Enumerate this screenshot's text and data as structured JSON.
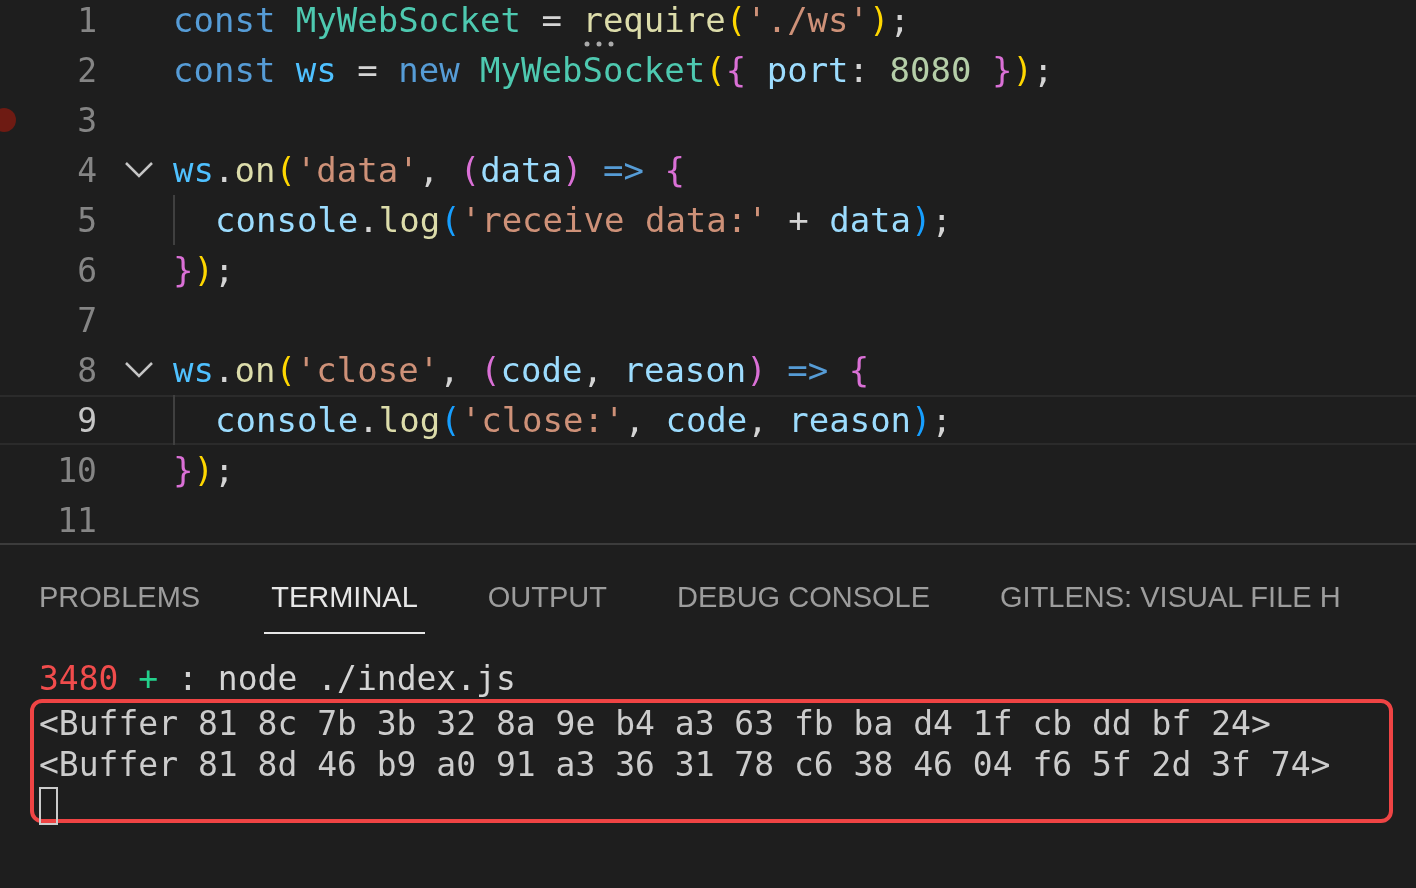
{
  "editor": {
    "lines": [
      {
        "number": "1",
        "foldable": false,
        "current": false,
        "breakpoint": false,
        "hint": true,
        "indent": false,
        "tokens": [
          {
            "text": "const ",
            "kind": "keyword"
          },
          {
            "text": "MyWebSocket",
            "kind": "class"
          },
          {
            "text": " = ",
            "kind": "plain"
          },
          {
            "text": "require",
            "kind": "function"
          },
          {
            "text": "(",
            "kind": "bracket1"
          },
          {
            "text": "'./ws'",
            "kind": "string"
          },
          {
            "text": ")",
            "kind": "bracket1"
          },
          {
            "text": ";",
            "kind": "plain"
          }
        ]
      },
      {
        "number": "2",
        "foldable": false,
        "current": false,
        "breakpoint": false,
        "hint": false,
        "indent": false,
        "tokens": [
          {
            "text": "const ",
            "kind": "keyword"
          },
          {
            "text": "ws",
            "kind": "constant"
          },
          {
            "text": " = ",
            "kind": "plain"
          },
          {
            "text": "new ",
            "kind": "keyword"
          },
          {
            "text": "MyWebSocket",
            "kind": "class"
          },
          {
            "text": "(",
            "kind": "bracket1"
          },
          {
            "text": "{ ",
            "kind": "bracket2"
          },
          {
            "text": "port",
            "kind": "variable"
          },
          {
            "text": ": ",
            "kind": "plain"
          },
          {
            "text": "8080 ",
            "kind": "number"
          },
          {
            "text": "}",
            "kind": "bracket2"
          },
          {
            "text": ")",
            "kind": "bracket1"
          },
          {
            "text": ";",
            "kind": "plain"
          }
        ]
      },
      {
        "number": "3",
        "foldable": false,
        "current": false,
        "breakpoint": true
      },
      {
        "number": "4",
        "foldable": true,
        "current": false,
        "breakpoint": false,
        "hint": false,
        "indent": false,
        "tokens": [
          {
            "text": "ws",
            "kind": "constant"
          },
          {
            "text": ".",
            "kind": "plain"
          },
          {
            "text": "on",
            "kind": "function"
          },
          {
            "text": "(",
            "kind": "bracket1"
          },
          {
            "text": "'data'",
            "kind": "string"
          },
          {
            "text": ", ",
            "kind": "plain"
          },
          {
            "text": "(",
            "kind": "bracket2"
          },
          {
            "text": "data",
            "kind": "variable"
          },
          {
            "text": ") ",
            "kind": "bracket2"
          },
          {
            "text": "=> ",
            "kind": "keyword"
          },
          {
            "text": "{",
            "kind": "bracket2"
          }
        ]
      },
      {
        "number": "5",
        "foldable": false,
        "current": false,
        "breakpoint": false,
        "hint": false,
        "indent": true,
        "tokens": [
          {
            "text": "console",
            "kind": "variable"
          },
          {
            "text": ".",
            "kind": "plain"
          },
          {
            "text": "log",
            "kind": "function"
          },
          {
            "text": "(",
            "kind": "bracket3"
          },
          {
            "text": "'receive data:'",
            "kind": "string"
          },
          {
            "text": " + ",
            "kind": "plain"
          },
          {
            "text": "data",
            "kind": "variable"
          },
          {
            "text": ")",
            "kind": "bracket3"
          },
          {
            "text": ";",
            "kind": "plain"
          }
        ]
      },
      {
        "number": "6",
        "foldable": false,
        "current": false,
        "breakpoint": false,
        "hint": false,
        "indent": false,
        "tokens": [
          {
            "text": "}",
            "kind": "bracket2"
          },
          {
            "text": ")",
            "kind": "bracket1"
          },
          {
            "text": ";",
            "kind": "plain"
          }
        ]
      },
      {
        "number": "7",
        "foldable": false,
        "current": false,
        "breakpoint": false
      },
      {
        "number": "8",
        "foldable": true,
        "current": false,
        "breakpoint": false,
        "hint": false,
        "indent": false,
        "tokens": [
          {
            "text": "ws",
            "kind": "constant"
          },
          {
            "text": ".",
            "kind": "plain"
          },
          {
            "text": "on",
            "kind": "function"
          },
          {
            "text": "(",
            "kind": "bracket1"
          },
          {
            "text": "'close'",
            "kind": "string"
          },
          {
            "text": ", ",
            "kind": "plain"
          },
          {
            "text": "(",
            "kind": "bracket2"
          },
          {
            "text": "code",
            "kind": "variable"
          },
          {
            "text": ", ",
            "kind": "plain"
          },
          {
            "text": "reason",
            "kind": "variable"
          },
          {
            "text": ") ",
            "kind": "bracket2"
          },
          {
            "text": "=> ",
            "kind": "keyword"
          },
          {
            "text": "{",
            "kind": "bracket2"
          }
        ]
      },
      {
        "number": "9",
        "foldable": false,
        "current": true,
        "breakpoint": false,
        "hint": false,
        "indent": true,
        "tokens": [
          {
            "text": "console",
            "kind": "variable"
          },
          {
            "text": ".",
            "kind": "plain"
          },
          {
            "text": "log",
            "kind": "function"
          },
          {
            "text": "(",
            "kind": "bracket3"
          },
          {
            "text": "'close:'",
            "kind": "string"
          },
          {
            "text": ", ",
            "kind": "plain"
          },
          {
            "text": "code",
            "kind": "variable"
          },
          {
            "text": ", ",
            "kind": "plain"
          },
          {
            "text": "reason",
            "kind": "variable"
          },
          {
            "text": ")",
            "kind": "bracket3"
          },
          {
            "text": ";",
            "kind": "plain"
          }
        ]
      },
      {
        "number": "10",
        "foldable": false,
        "current": false,
        "breakpoint": false,
        "hint": false,
        "indent": false,
        "tokens": [
          {
            "text": "}",
            "kind": "bracket2"
          },
          {
            "text": ")",
            "kind": "bracket1"
          },
          {
            "text": ";",
            "kind": "plain"
          }
        ]
      },
      {
        "number": "11",
        "foldable": false,
        "current": false,
        "breakpoint": false
      }
    ]
  },
  "panel": {
    "tabs": [
      {
        "label": "PROBLEMS",
        "selected": false
      },
      {
        "label": "TERMINAL",
        "selected": true
      },
      {
        "label": "OUTPUT",
        "selected": false
      },
      {
        "label": "DEBUG CONSOLE",
        "selected": false
      },
      {
        "label": "GITLENS: VISUAL FILE H",
        "selected": false
      }
    ],
    "terminal": {
      "prompt": [
        {
          "text": "3480 ",
          "kind": "error"
        },
        {
          "text": "+",
          "kind": "success"
        },
        {
          "text": " : node ./index.js",
          "kind": "plain"
        }
      ],
      "output": [
        "<Buffer 81 8c 7b 3b 32 8a 9e b4 a3 63 fb ba d4 1f cb dd bf 24>",
        "<Buffer 81 8d 46 b9 a0 91 a3 36 31 78 c6 38 46 04 f6 5f 2d 3f 74>"
      ],
      "highlighted": true
    }
  }
}
